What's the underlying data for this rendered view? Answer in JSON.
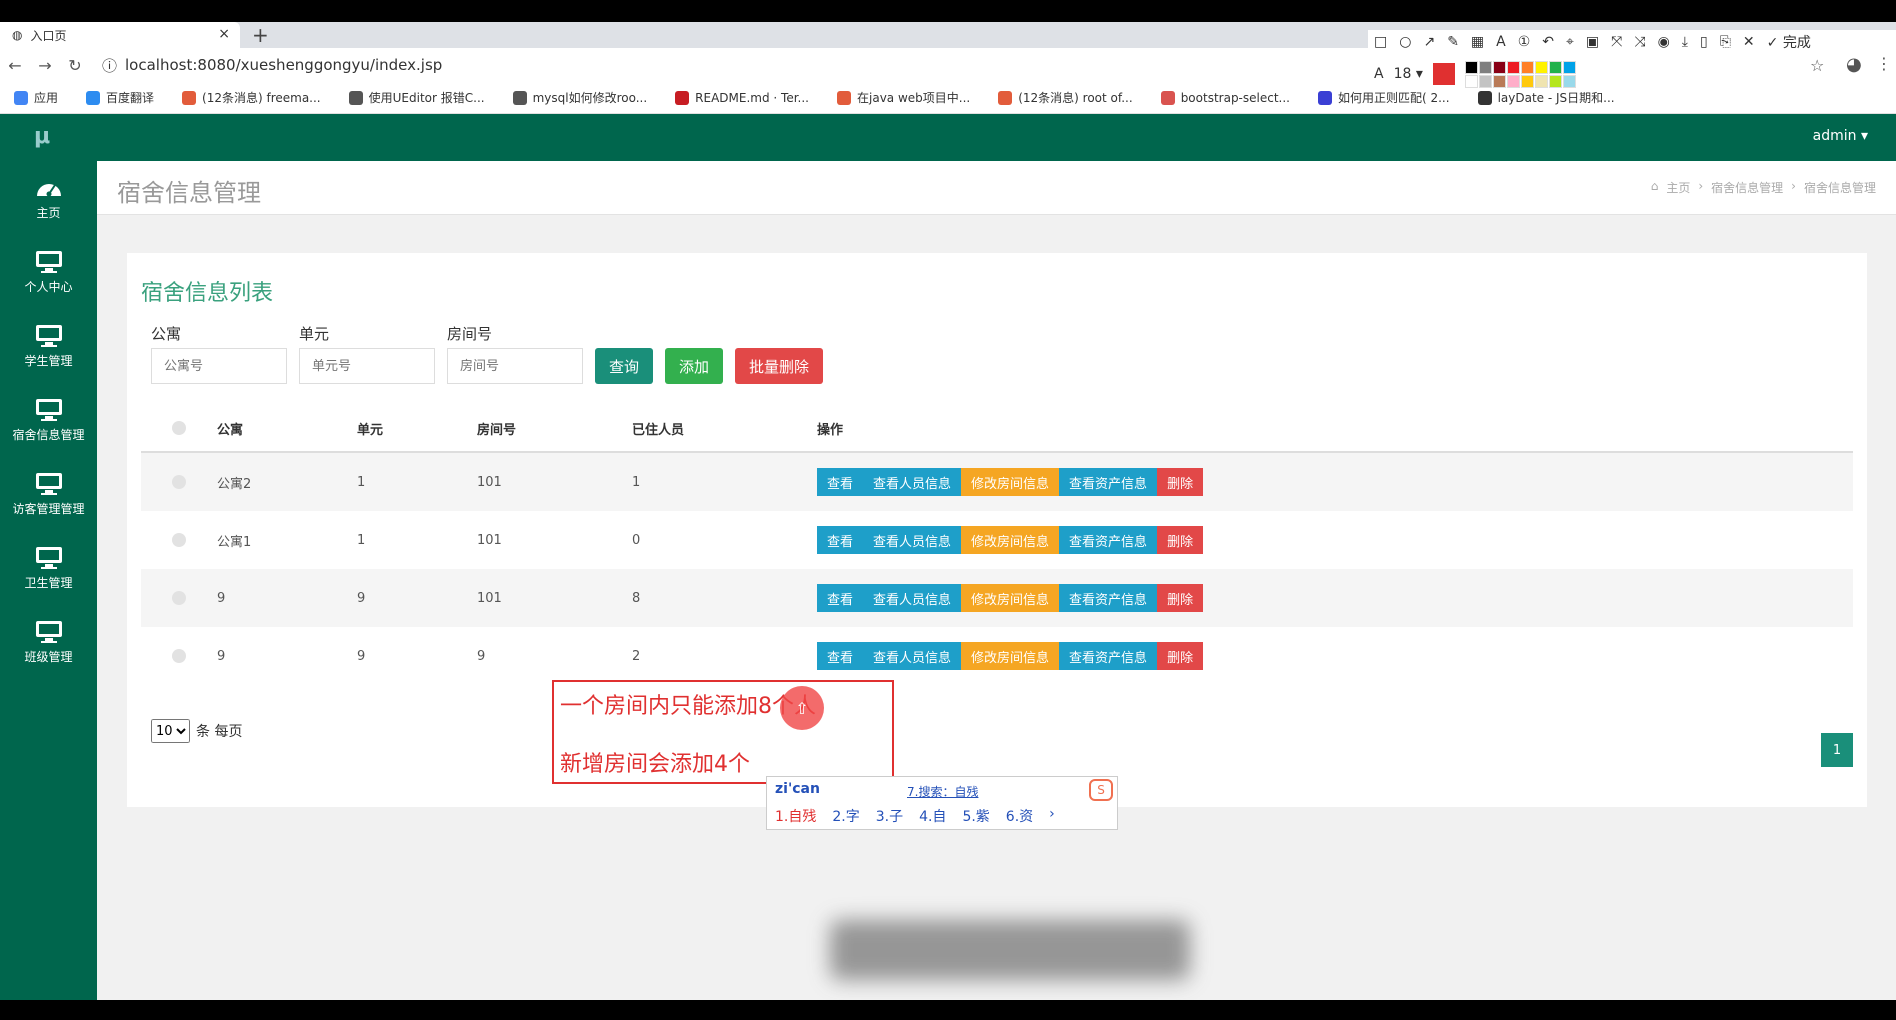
{
  "browser": {
    "tab_title": "入口页",
    "url": "localhost:8080/xueshenggongyu/index.jsp",
    "bookmarks": [
      {
        "label": "应用",
        "color": "#4285f4"
      },
      {
        "label": "百度翻译",
        "color": "#2d8cf0"
      },
      {
        "label": "(12条消息) freema...",
        "color": "#e25c3b"
      },
      {
        "label": "使用UEditor 报错C...",
        "color": "#555555"
      },
      {
        "label": "mysql如何修改roo...",
        "color": "#555555"
      },
      {
        "label": "README.md · Ter...",
        "color": "#c71d23"
      },
      {
        "label": "在java web项目中...",
        "color": "#e25c3b"
      },
      {
        "label": "(12条消息) root of...",
        "color": "#e25c3b"
      },
      {
        "label": "bootstrap-select...",
        "color": "#d9534f"
      },
      {
        "label": "如何用正则匹配( 2...",
        "color": "#3a3fd4"
      },
      {
        "label": "layDate - JS日期和...",
        "color": "#333333"
      }
    ]
  },
  "annotation_toolbar": {
    "font_size": "18",
    "done_label": "完成",
    "active_color": "#e03030",
    "palette": [
      "#000000",
      "#7f7f7f",
      "#880015",
      "#ed1c24",
      "#ff7f27",
      "#fff200",
      "#22b14c",
      "#00a2e8",
      "#ffffff",
      "#c3c3c3",
      "#b97a57",
      "#ffaec9",
      "#ffc90e",
      "#efe4b0",
      "#b5e61d",
      "#99d9ea"
    ]
  },
  "app": {
    "logo": "μ",
    "user": "admin ▾",
    "sidebar": [
      {
        "label": "主页",
        "icon": "dashboard-icon"
      },
      {
        "label": "个人中心",
        "icon": "monitor-icon"
      },
      {
        "label": "学生管理",
        "icon": "monitor-icon"
      },
      {
        "label": "宿舍信息管理",
        "icon": "monitor-icon"
      },
      {
        "label": "访客管理管理",
        "icon": "monitor-icon"
      },
      {
        "label": "卫生管理",
        "icon": "monitor-icon"
      },
      {
        "label": "班级管理",
        "icon": "monitor-icon"
      }
    ],
    "page_title": "宿舍信息管理",
    "breadcrumb": [
      "主页",
      "宿舍信息管理",
      "宿舍信息管理"
    ],
    "panel_title": "宿舍信息列表",
    "filters": [
      {
        "label": "公寓",
        "placeholder": "公寓号"
      },
      {
        "label": "单元",
        "placeholder": "单元号"
      },
      {
        "label": "房间号",
        "placeholder": "房间号"
      }
    ],
    "buttons": {
      "query": "查询",
      "add": "添加",
      "batch_delete": "批量删除"
    },
    "table": {
      "headers": [
        "公寓",
        "单元",
        "房间号",
        "已住人员",
        "操作"
      ],
      "rows": [
        {
          "apartment": "公寓2",
          "unit": "1",
          "room": "101",
          "occupants": "1"
        },
        {
          "apartment": "公寓1",
          "unit": "1",
          "room": "101",
          "occupants": "0"
        },
        {
          "apartment": "9",
          "unit": "9",
          "room": "101",
          "occupants": "8"
        },
        {
          "apartment": "9",
          "unit": "9",
          "room": "9",
          "occupants": "2"
        }
      ],
      "actions": [
        "查看",
        "查看人员信息",
        "修改房间信息",
        "查看资产信息",
        "删除"
      ]
    },
    "pager": {
      "per_page": "10",
      "suffix": "条 每页",
      "current_page": "1"
    }
  },
  "overlay_note": {
    "line1": "一个房间内只能添加8个人",
    "line2": "新增房间会添加4个"
  },
  "ime": {
    "pinyin": "zi'can",
    "search": "7.搜索：自残",
    "candidates": [
      "1.自残",
      "2.字",
      "3.子",
      "4.自",
      "5.紫",
      "6.资"
    ]
  }
}
